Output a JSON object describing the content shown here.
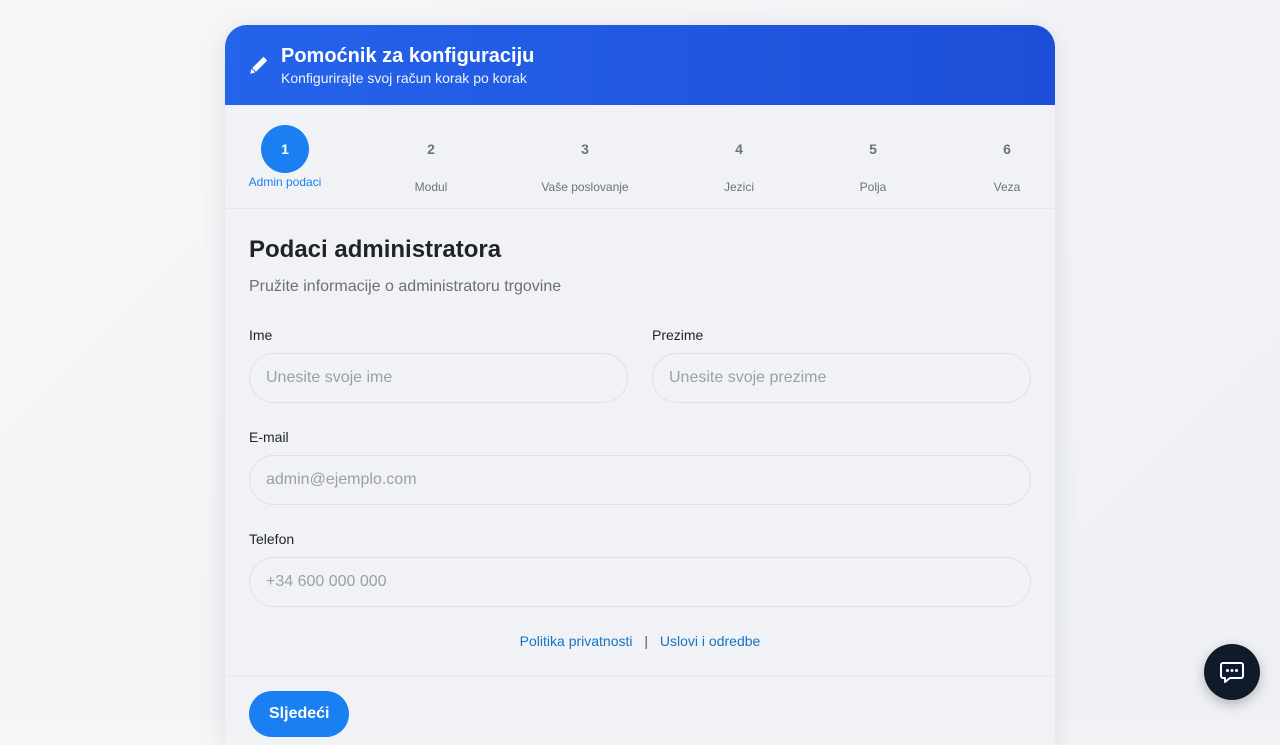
{
  "header": {
    "icon": "pen-icon",
    "title": "Pomoćnik za konfiguraciju",
    "subtitle": "Konfigurirajte svoj račun korak po korak"
  },
  "steps": [
    {
      "number": "1",
      "label": "Admin podaci",
      "active": true
    },
    {
      "number": "2",
      "label": "Modul",
      "active": false
    },
    {
      "number": "3",
      "label": "Vaše poslovanje",
      "active": false
    },
    {
      "number": "4",
      "label": "Jezici",
      "active": false
    },
    {
      "number": "5",
      "label": "Polja",
      "active": false
    },
    {
      "number": "6",
      "label": "Veza",
      "active": false
    }
  ],
  "form": {
    "title": "Podaci administratora",
    "subtitle": "Pružite informacije o administratoru trgovine",
    "first_name": {
      "label": "Ime",
      "placeholder": "Unesite svoje ime",
      "value": ""
    },
    "last_name": {
      "label": "Prezime",
      "placeholder": "Unesite svoje prezime",
      "value": ""
    },
    "email": {
      "label": "E-mail",
      "placeholder": "admin@ejemplo.com",
      "value": ""
    },
    "phone": {
      "label": "Telefon",
      "placeholder": "+34 600 000 000",
      "value": ""
    }
  },
  "links": {
    "privacy": "Politika privatnosti",
    "separator": "|",
    "terms": "Uslovi i odredbe"
  },
  "footer": {
    "next_label": "Sljedeći"
  },
  "chat": {
    "icon": "chat-bubble-icon"
  },
  "colors": {
    "header_start": "#2563eb",
    "header_end": "#1d4ed8",
    "accent": "#1a7ff0",
    "link": "#1573c7",
    "chat_bg": "#0f1b2d"
  }
}
